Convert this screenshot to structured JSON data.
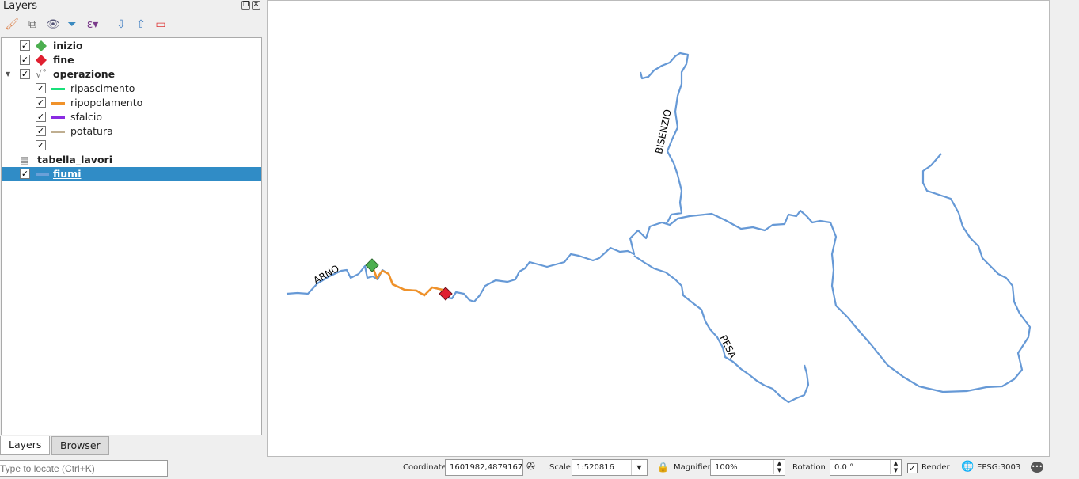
{
  "panel": {
    "title": "Layers",
    "toolbar_icons": [
      "style-manager-icon",
      "add-group-icon",
      "visibility-icon",
      "filter-icon",
      "expression-filter-icon",
      "expand-all-icon",
      "collapse-all-icon",
      "remove-layer-icon"
    ]
  },
  "layers": [
    {
      "name": "inizio",
      "checked": true,
      "symbol": "diamond",
      "color": "#4caf50",
      "bold": true
    },
    {
      "name": "fine",
      "checked": true,
      "symbol": "diamond",
      "color": "#e02030",
      "bold": true
    },
    {
      "name": "operazione",
      "checked": true,
      "symbol": "rule-based",
      "bold": true,
      "expanded": true,
      "classes": [
        {
          "name": "ripascimento",
          "checked": true,
          "color": "#19e07a"
        },
        {
          "name": "ripopolamento",
          "checked": true,
          "color": "#f0922a"
        },
        {
          "name": "sfalcio",
          "checked": true,
          "color": "#8a2be2"
        },
        {
          "name": "potatura",
          "checked": true,
          "color": "#bfae90"
        },
        {
          "name": "",
          "checked": true,
          "color": "#e8c060"
        }
      ]
    },
    {
      "name": "tabella_lavori",
      "symbol": "table",
      "bold": true
    },
    {
      "name": "fiumi",
      "checked": true,
      "color": "#6aa0d8",
      "bold": true,
      "selected": true
    }
  ],
  "tabs": [
    "Layers",
    "Browser"
  ],
  "map": {
    "labels": [
      "ARNO",
      "BISENZIO",
      "PESA"
    ],
    "river_color": "#6699d6",
    "highlight_color": "#f0922a"
  },
  "statusbar": {
    "locator_placeholder": "Type to locate (Ctrl+K)",
    "coordinate_label": "Coordinate",
    "coordinate": "1601982,4879167",
    "scale_label": "Scale",
    "scale": "1:520816",
    "magnifier_label": "Magnifier",
    "magnifier": "100%",
    "rotation_label": "Rotation",
    "rotation": "0.0 °",
    "render_label": "Render",
    "render_checked": true,
    "crs": "EPSG:3003"
  }
}
